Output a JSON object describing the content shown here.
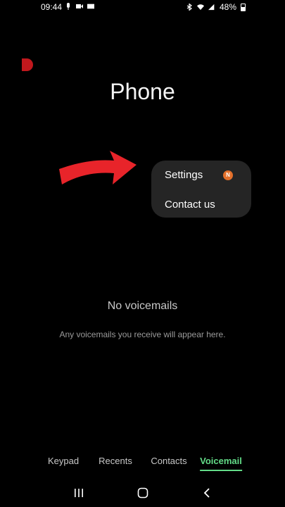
{
  "status_bar": {
    "time": "09:44",
    "battery": "48%",
    "left_icons": [
      "mic-icon",
      "video-icon",
      "lte-icon"
    ],
    "right_icons": [
      "bluetooth-icon",
      "wifi-icon",
      "call-signal-icon",
      "battery-icon"
    ]
  },
  "page": {
    "title": "Phone"
  },
  "popup_menu": {
    "items": [
      {
        "label": "Settings",
        "badge": "N"
      },
      {
        "label": "Contact us"
      }
    ]
  },
  "empty_state": {
    "title": "No voicemails",
    "subtitle": "Any voicemails you receive will appear here."
  },
  "tabs": [
    {
      "label": "Keypad",
      "active": false
    },
    {
      "label": "Recents",
      "active": false
    },
    {
      "label": "Contacts",
      "active": false
    },
    {
      "label": "Voicemail",
      "active": true
    }
  ],
  "colors": {
    "background": "#000000",
    "accent_green": "#63dc88",
    "menu_bg": "#252525",
    "badge": "#e3702b",
    "arrow": "#e8242a"
  },
  "nav_bar": [
    "recents-icon",
    "home-icon",
    "back-icon"
  ]
}
